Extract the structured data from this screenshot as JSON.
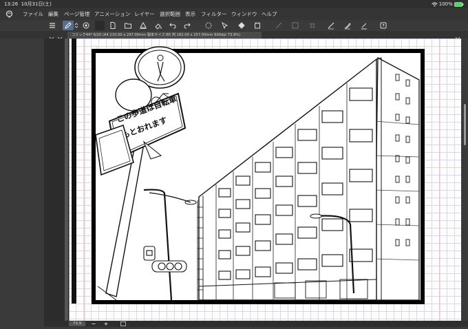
{
  "status_bar": {
    "time": "13:26",
    "date": "10月31日(土)",
    "battery": "100%"
  },
  "menu": [
    {
      "label": "ファイル"
    },
    {
      "label": "編集"
    },
    {
      "label": "ページ管理"
    },
    {
      "label": "アニメーション"
    },
    {
      "label": "レイヤー"
    },
    {
      "label": "選択範囲"
    },
    {
      "label": "表示"
    },
    {
      "label": "フィルター"
    },
    {
      "label": "ウィンドウ"
    },
    {
      "label": "ヘルプ"
    }
  ],
  "document_tab": {
    "title": "コミック44* 6/20 (A4 210.00 x 297.00mm 製本サイズ:B5 判 182.00 x 257.00mm 600dpi 73.9%)"
  },
  "artwork": {
    "sign_line1": "この歩道は自転車",
    "sign_line2": "もとおれます"
  },
  "bottom_bar": {
    "zoom": "73.9"
  }
}
